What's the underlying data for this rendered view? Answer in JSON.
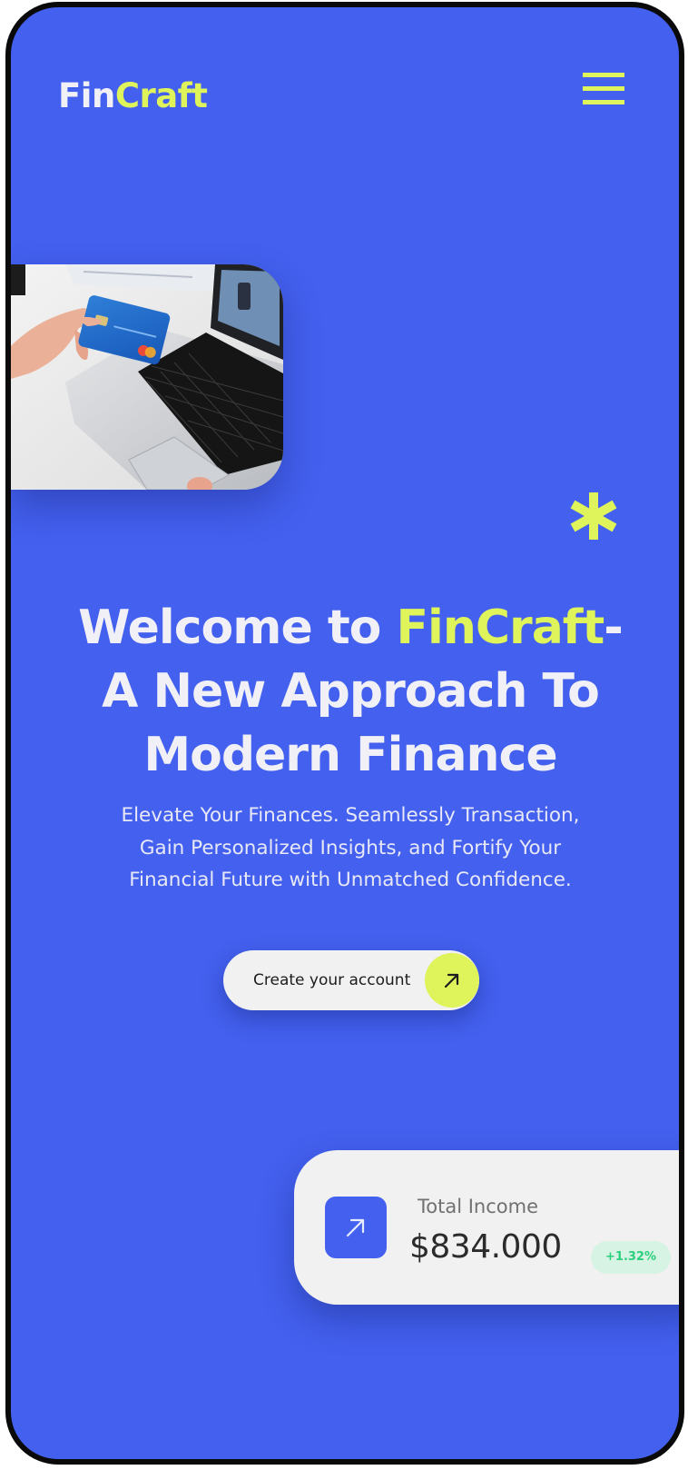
{
  "header": {
    "logo_part1": "Fin",
    "logo_part2": "Craft",
    "menu_icon": "hamburger-menu-icon"
  },
  "hero": {
    "image": "hand-holding-credit-card-over-laptop",
    "decoration_icon": "asterisk-icon",
    "headline": {
      "part1": "Welcome to ",
      "brand": "FinCraft",
      "part2": "-",
      "line2": "A New Approach To",
      "line3": "Modern Finance"
    },
    "subtext_lines": [
      "Elevate Your Finances. Seamlessly Transaction,",
      "Gain Personalized Insights, and Fortify Your",
      "Financial Future with Unmatched Confidence."
    ],
    "cta_label": "Create your account",
    "cta_icon": "arrow-up-right-icon"
  },
  "income_card": {
    "icon": "arrow-up-right-icon",
    "label": "Total Income",
    "value": "$834.000",
    "change": "+1.32%"
  },
  "colors": {
    "background": "#4360ee",
    "accent": "#dff35b",
    "text_light": "#f1f0f7",
    "card_bg": "#f1f1f1",
    "positive": "#2bd07c"
  }
}
